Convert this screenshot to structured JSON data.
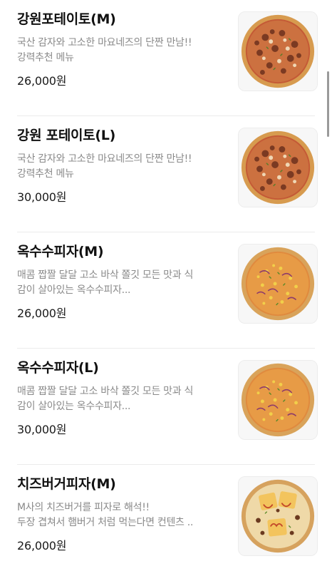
{
  "menu": {
    "items": [
      {
        "name": "강원포테이토(M)",
        "desc_lines": [
          "국산 감자와 고소한 마요네즈의 단짠 만남!!",
          "강력추천 메뉴"
        ],
        "price": "26,000원",
        "image": "potato-pizza-image"
      },
      {
        "name": "강원 포테이토(L)",
        "desc_lines": [
          "국산 감자와 고소한 마요네즈의 단짠 만남!!",
          "강력추천 메뉴"
        ],
        "price": "30,000원",
        "image": "potato-pizza-image"
      },
      {
        "name": "옥수수피자(M)",
        "desc_lines": [
          "매콤 짭짤 달달 고소 바삭 쫄깃 모든 맛과 식",
          "감이 살아있는 옥수수피자..."
        ],
        "price": "26,000원",
        "image": "corn-pizza-image"
      },
      {
        "name": "옥수수피자(L)",
        "desc_lines": [
          "매콤 짭짤 달달 고소 바삭 쫄깃 모든 맛과 식",
          "감이 살아있는 옥수수피자..."
        ],
        "price": "30,000원",
        "image": "corn-pizza-image"
      },
      {
        "name": "치즈버거피자(M)",
        "desc_lines": [
          "M사의 치즈버거를 피자로 해석!!",
          "두장 겹쳐서 햄버거 처럼 먹는다면 컨텐츠 .."
        ],
        "price": "26,000원",
        "image": "cheeseburger-pizza-image"
      }
    ]
  },
  "colors": {
    "text_primary": "#111111",
    "text_secondary": "#8a8a8a",
    "divider": "#ebebeb",
    "crust": "#d9a35a",
    "sauce": "#b5462c",
    "cheese": "#f2cf6e"
  }
}
